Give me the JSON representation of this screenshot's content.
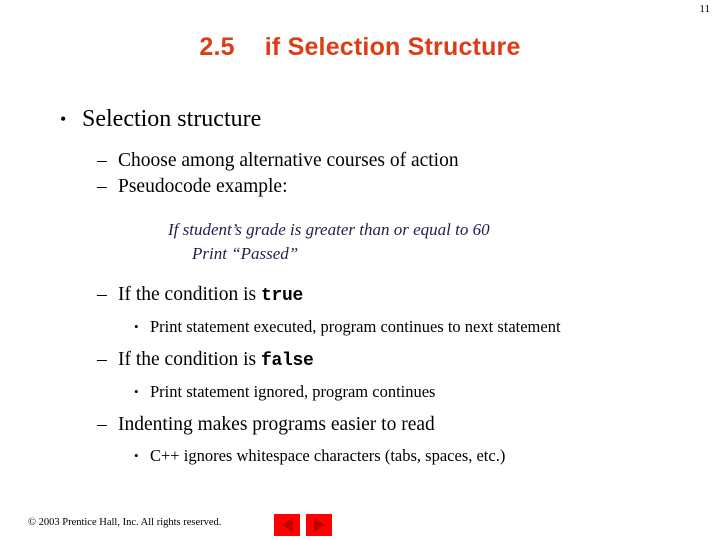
{
  "page": {
    "number": "11",
    "background_color": "#FFFFFF"
  },
  "title": {
    "section_number": "2.5",
    "text": "if Selection Structure",
    "color": "#DD3C14"
  },
  "content": {
    "bullet_glyph": "•",
    "dash_glyph": "–",
    "level1": {
      "label": "Selection structure"
    },
    "level2_items": [
      {
        "label": "Choose among alternative courses of action"
      },
      {
        "label": "Pseudocode example:"
      }
    ],
    "pseudocode": {
      "color": "#1F1F4B",
      "line1": "If student’s grade is greater than or equal to 60",
      "line2": "Print “Passed”"
    },
    "true_branch": {
      "prefix": "If the condition is ",
      "keyword": "true",
      "detail": "Print statement executed, program continues to next statement"
    },
    "false_branch": {
      "prefix": "If the condition is ",
      "keyword": "false",
      "detail": "Print statement ignored, program continues"
    },
    "indenting": {
      "label": "Indenting makes programs easier to read",
      "detail": "C++ ignores whitespace characters (tabs, spaces, etc.)"
    }
  },
  "footer": {
    "copyright": "© 2003 Prentice Hall, Inc. All rights reserved.",
    "nav": {
      "previous_icon": "triangle-left-icon",
      "next_icon": "triangle-right-icon",
      "button_color": "#FF0000",
      "arrow_color": "#C00000"
    }
  }
}
